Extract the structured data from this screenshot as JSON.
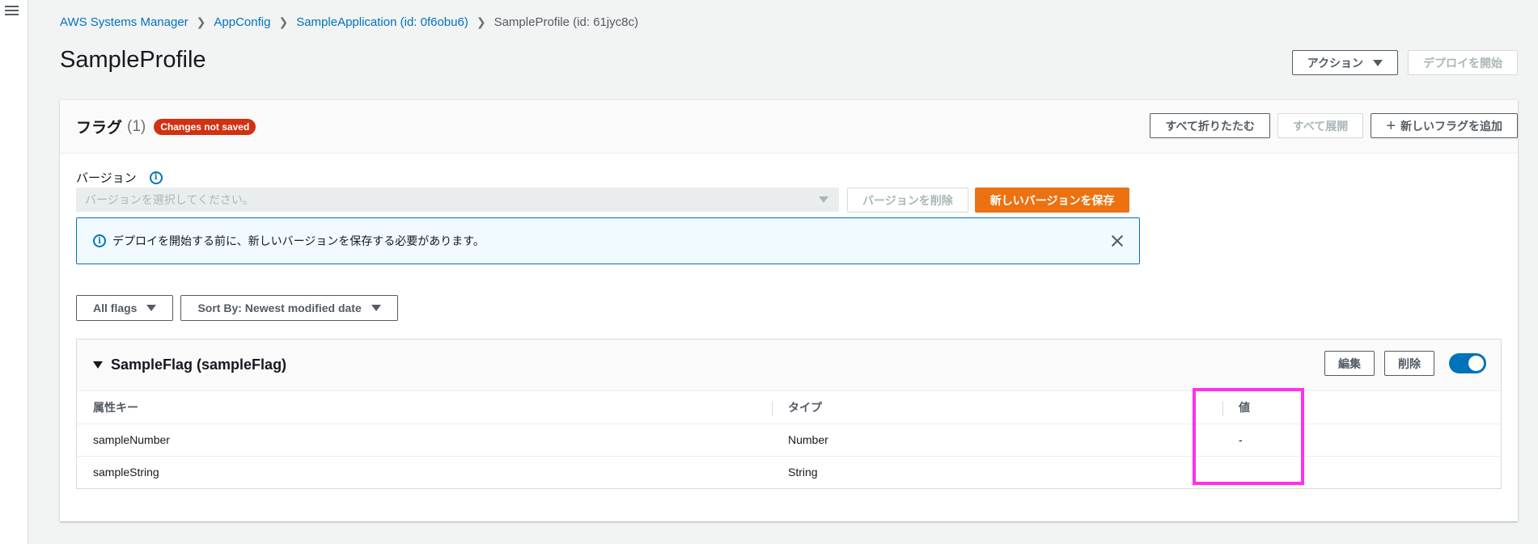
{
  "breadcrumb": {
    "items": [
      "AWS Systems Manager",
      "AppConfig",
      "SampleApplication (id: 0f6obu6)"
    ],
    "current": "SampleProfile (id: 61jyc8c)"
  },
  "page": {
    "title": "SampleProfile",
    "actions_label": "アクション",
    "deploy_label": "デプロイを開始"
  },
  "flags_panel": {
    "title": "フラグ",
    "count": "(1)",
    "badge": "Changes not saved",
    "collapse_all": "すべて折りたたむ",
    "expand_all": "すべて展開",
    "add_flag": "新しいフラグを追加"
  },
  "version": {
    "label": "バージョン",
    "placeholder": "バージョンを選択してください。",
    "delete_label": "バージョンを削除",
    "save_label": "新しいバージョンを保存"
  },
  "alert": {
    "message": "デプロイを開始する前に、新しいバージョンを保存する必要があります。"
  },
  "filters": {
    "flag_filter": "All flags",
    "sort": "Sort By: Newest modified date"
  },
  "flag_card": {
    "name": "SampleFlag (sampleFlag)",
    "edit_label": "編集",
    "delete_label": "削除",
    "enabled": true,
    "columns": [
      "属性キー",
      "タイプ",
      "値"
    ],
    "rows": [
      {
        "key": "sampleNumber",
        "type": "Number",
        "value": "-"
      },
      {
        "key": "sampleString",
        "type": "String",
        "value": ""
      }
    ]
  },
  "colors": {
    "link": "#0073bb",
    "primary": "#ec7211",
    "badge": "#d13212",
    "highlight": "#ff2ff0"
  }
}
